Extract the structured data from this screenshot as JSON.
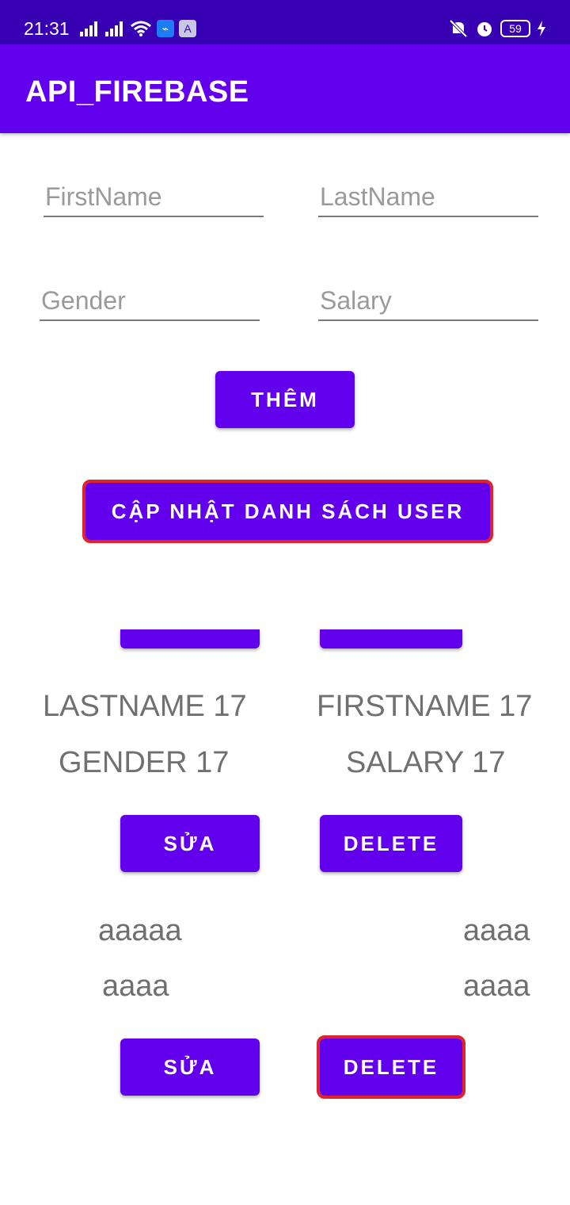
{
  "status_bar": {
    "time": "21:31",
    "battery_level": "59",
    "icons": [
      "signal-icon",
      "signal-icon",
      "wifi-icon",
      "usb-icon",
      "app-store-icon",
      "mute-vibrate-icon",
      "alarm-icon",
      "battery-icon",
      "charging-icon"
    ]
  },
  "app_bar": {
    "title": "API_FIREBASE"
  },
  "form": {
    "first_name_placeholder": "FirstName",
    "last_name_placeholder": "LastName",
    "gender_placeholder": "Gender",
    "salary_placeholder": "Salary",
    "add_button_label": "THÊM",
    "refresh_button_label": "CẬP NHẬT DANH SÁCH USER"
  },
  "users": [
    {
      "last_name": "LASTNAME 17",
      "first_name": "FIRSTNAME 17",
      "gender": "GENDER 17",
      "salary": "SALARY 17",
      "edit_label": "SỬA",
      "delete_label": "DELETE"
    },
    {
      "last_name": "aaaaa",
      "first_name": "aaaa",
      "gender": "aaaa",
      "salary": "aaaa",
      "edit_label": "SỬA",
      "delete_label": "DELETE"
    }
  ],
  "colors": {
    "status_bar": "#3700B3",
    "primary": "#6200EE",
    "highlight": "#e0222a",
    "text_secondary": "#707070"
  }
}
